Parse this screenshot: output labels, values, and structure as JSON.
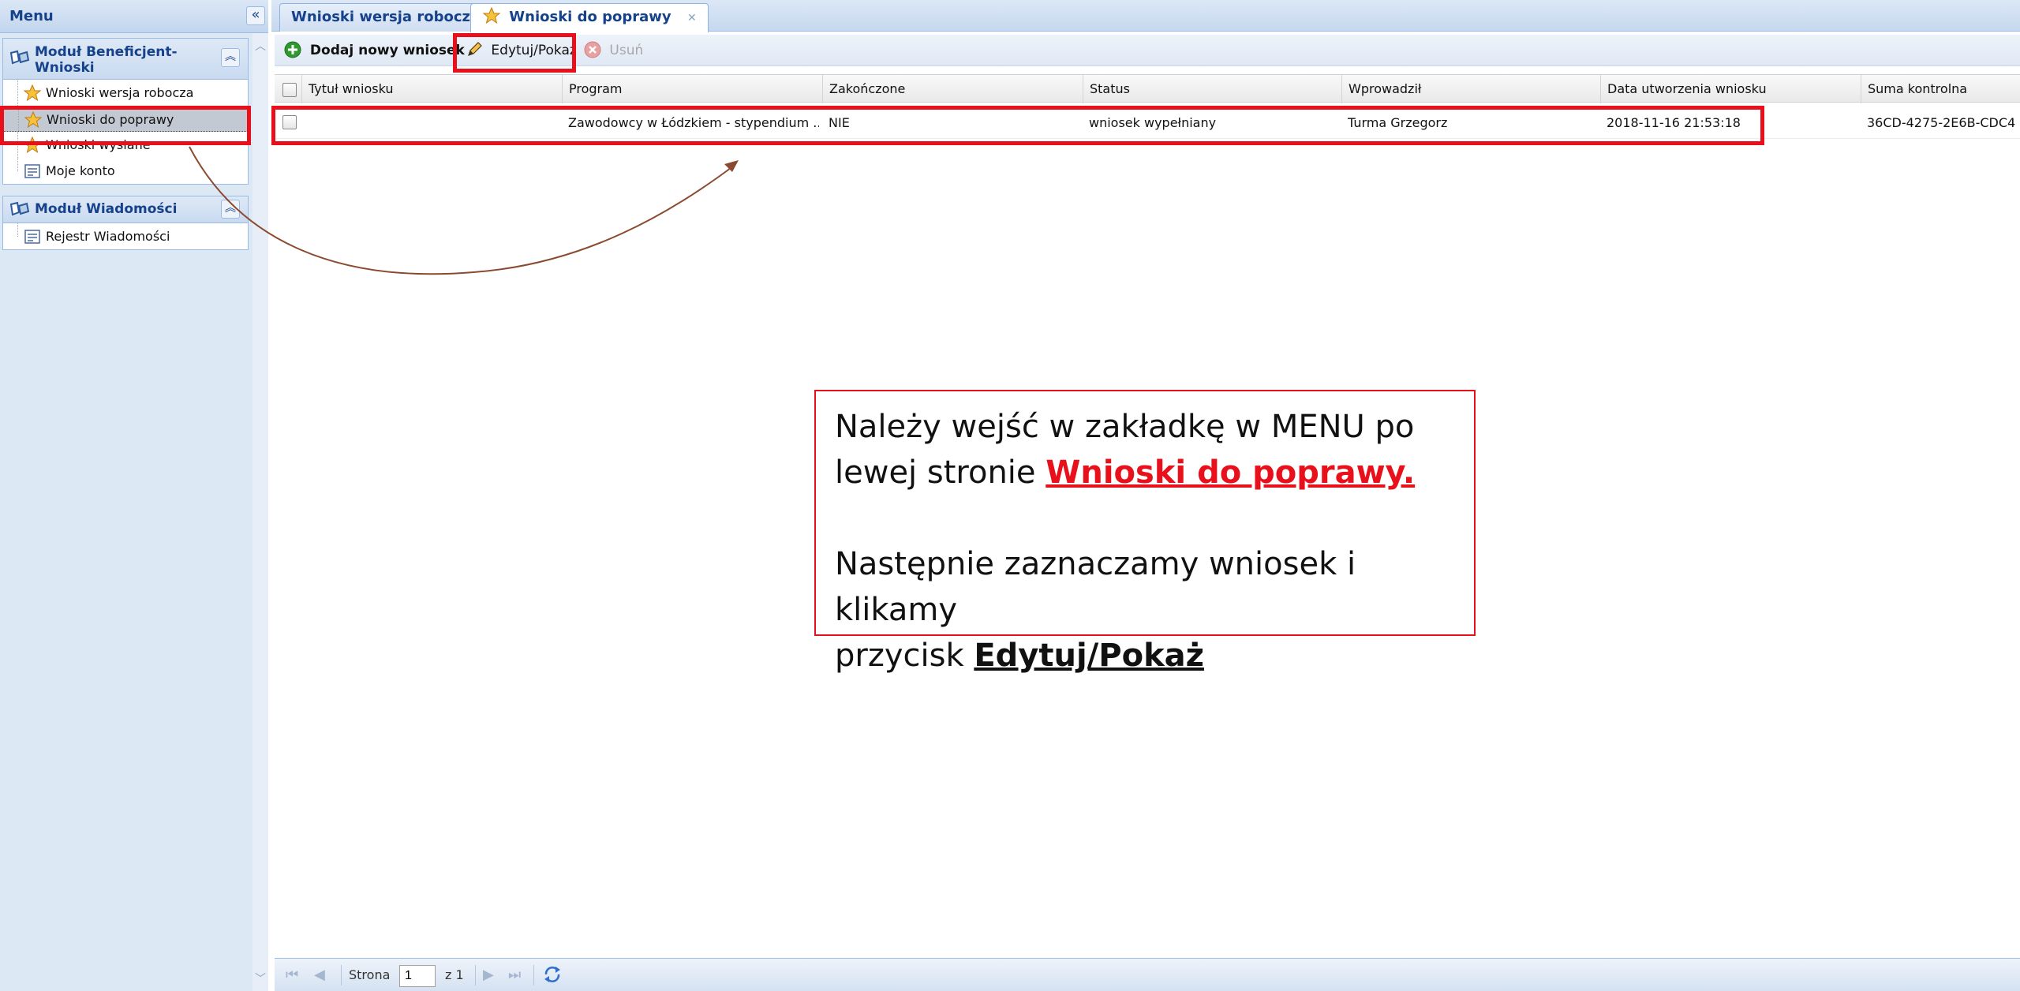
{
  "sidebar": {
    "title": "Menu",
    "collapse_glyph": "«",
    "modules": [
      {
        "title": "Moduł Beneficjent-Wnioski",
        "items": [
          {
            "label": "Wnioski wersja robocza",
            "icon": "star-icon"
          },
          {
            "label": "Wnioski do poprawy",
            "icon": "star-icon",
            "selected": true
          },
          {
            "label": "Wnioski wysłane",
            "icon": "star-icon"
          },
          {
            "label": "Moje konto",
            "icon": "form-icon"
          }
        ]
      },
      {
        "title": "Moduł Wiadomości",
        "items": [
          {
            "label": "Rejestr Wiadomości",
            "icon": "form-icon"
          }
        ]
      }
    ]
  },
  "tabs": [
    {
      "label": "Wnioski wersja robocza",
      "active": false
    },
    {
      "label": "Wnioski do poprawy",
      "active": true,
      "icon": "star-icon"
    }
  ],
  "toolbar": {
    "add_label": "Dodaj nowy wniosek",
    "edit_label": "Edytuj/Pokaż",
    "delete_label": "Usuń"
  },
  "grid": {
    "columns": [
      "Tytuł wniosku",
      "Program",
      "Zakończone",
      "Status",
      "Wprowadził",
      "Data utworzenia wniosku",
      "Suma kontrolna"
    ],
    "rows": [
      {
        "title": "",
        "program": "Zawodowcy w Łódzkiem - stypendium ...",
        "finished": "NIE",
        "status": "wniosek wypełniany",
        "entered_by": "Turma Grzegorz",
        "created": "2018-11-16 21:53:18",
        "checksum": "36CD-4275-2E6B-CDC4"
      }
    ]
  },
  "pager": {
    "page_label": "Strona",
    "page_value": "1",
    "of_label": "z 1"
  },
  "callout": {
    "line1": "Należy wejść w zakładkę w MENU po",
    "line2_prefix": "lewej stronie ",
    "line2_link": "Wnioski do poprawy.",
    "line3": "Następnie zaznaczamy wniosek i klikamy",
    "line4_prefix": "przycisk ",
    "line4_bold": "Edytuj/Pokaż"
  },
  "colors": {
    "annotation_red": "#e8101b",
    "header_blue": "#15428b",
    "panel_bg": "#dde8f5"
  }
}
